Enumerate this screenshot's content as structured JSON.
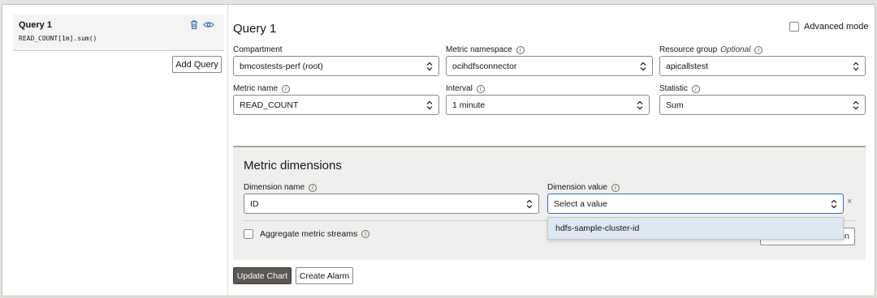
{
  "query_list": {
    "items": [
      {
        "title": "Query 1",
        "expression": "READ_COUNT[1m].sum()"
      }
    ],
    "add_label": "Add Query"
  },
  "editor": {
    "heading": "Query 1",
    "advanced_mode_label": "Advanced mode",
    "fields": {
      "compartment": {
        "label": "Compartment",
        "value": "bmcostests-perf (root)"
      },
      "metric_namespace": {
        "label": "Metric namespace",
        "value": "ocihdfsconnector"
      },
      "resource_group": {
        "label": "Resource group",
        "optional_label": "Optional",
        "value": "apicallstest"
      },
      "metric_name": {
        "label": "Metric name",
        "value": "READ_COUNT"
      },
      "interval": {
        "label": "Interval",
        "value": "1 minute"
      },
      "statistic": {
        "label": "Statistic",
        "value": "Sum"
      }
    },
    "dimensions": {
      "title": "Metric dimensions",
      "name_label": "Dimension name",
      "name_value": "ID",
      "value_label": "Dimension value",
      "value_placeholder": "Select a value",
      "options": [
        "hdfs-sample-cluster-id"
      ],
      "aggregate_label": "Aggregate metric streams",
      "hidden_button_partial": "on"
    },
    "actions": {
      "update_chart": "Update Chart",
      "create_alarm": "Create Alarm"
    }
  },
  "icons": {
    "info": "i",
    "remove": "×"
  },
  "colors": {
    "primary_button": "#5b5652",
    "dropdown_highlight": "#dde8f5",
    "accent_icon": "#2a6ebb"
  }
}
